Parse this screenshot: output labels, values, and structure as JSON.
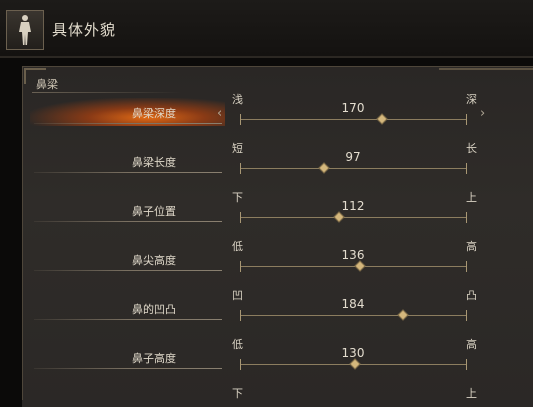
{
  "header": {
    "title": "具体外貌",
    "avatar_icon": "body-figure-icon"
  },
  "section": {
    "label": "鼻梁"
  },
  "sliders": [
    {
      "label": "鼻梁深度",
      "min_label": "浅",
      "max_label": "深",
      "value": "170",
      "fraction": 0.63,
      "selected": true
    },
    {
      "label": "鼻梁长度",
      "min_label": "短",
      "max_label": "长",
      "value": "97",
      "fraction": 0.37,
      "selected": false
    },
    {
      "label": "鼻子位置",
      "min_label": "下",
      "max_label": "上",
      "value": "112",
      "fraction": 0.44,
      "selected": false
    },
    {
      "label": "鼻尖高度",
      "min_label": "低",
      "max_label": "高",
      "value": "136",
      "fraction": 0.53,
      "selected": false
    },
    {
      "label": "鼻的凹凸",
      "min_label": "凹",
      "max_label": "凸",
      "value": "184",
      "fraction": 0.72,
      "selected": false
    },
    {
      "label": "鼻子高度",
      "min_label": "低",
      "max_label": "高",
      "value": "130",
      "fraction": 0.51,
      "selected": false
    },
    {
      "label": "",
      "min_label": "下",
      "max_label": "上",
      "value": "",
      "fraction": 0,
      "selected": false
    }
  ],
  "colors": {
    "accent": "#e8701a",
    "track": "#8c7d5f",
    "thumb": "#d4b77c"
  }
}
